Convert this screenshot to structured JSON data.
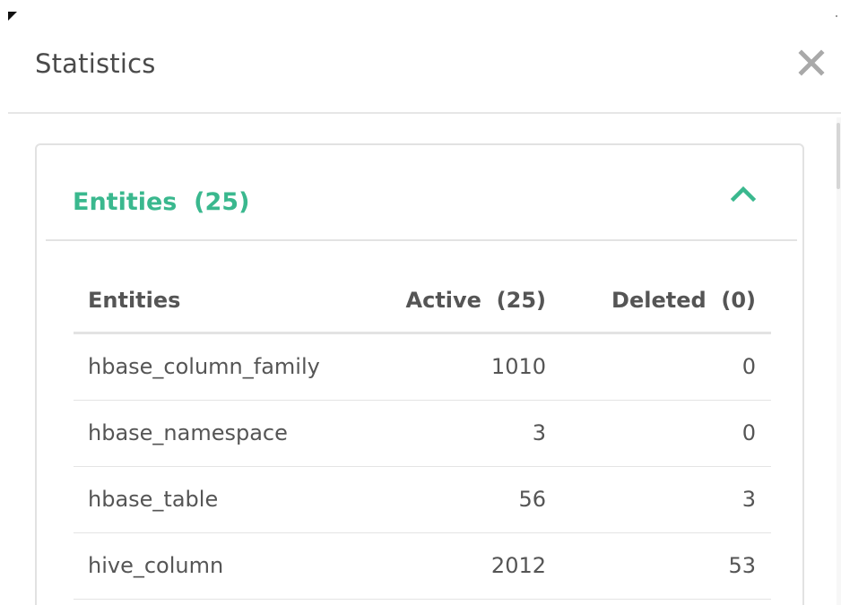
{
  "modal": {
    "title": "Statistics",
    "close_icon": "close-icon"
  },
  "panel": {
    "title": "Entities  (25)",
    "toggle_icon": "chevron-up-icon",
    "accent_color": "#3ab88e"
  },
  "table": {
    "headers": [
      "Entities",
      "Active  (25)",
      "Deleted  (0)"
    ],
    "rows": [
      {
        "name": "hbase_column_family",
        "active": "1010",
        "deleted": "0"
      },
      {
        "name": "hbase_namespace",
        "active": "3",
        "deleted": "0"
      },
      {
        "name": "hbase_table",
        "active": "56",
        "deleted": "3"
      },
      {
        "name": "hive_column",
        "active": "2012",
        "deleted": "53"
      }
    ]
  }
}
